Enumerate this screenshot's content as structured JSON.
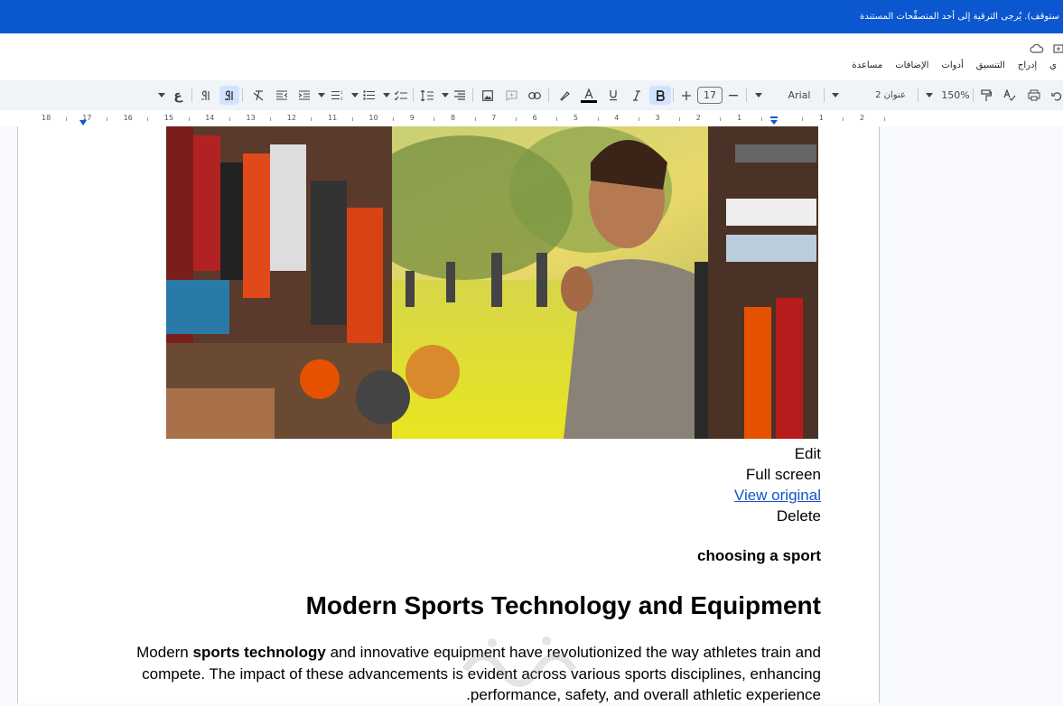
{
  "banner": {
    "text": "ستوقف). يُرجى الترقية إلى أحد المتصفِّحات المستندة"
  },
  "menu": {
    "items": [
      "ي",
      "إدراج",
      "التنسيق",
      "أدوات",
      "الإضافات",
      "مساعدة"
    ]
  },
  "toolbar": {
    "zoom": "150%",
    "style": "عنوان 2",
    "font": "Arial",
    "font_size": "17",
    "lang_label": "ع"
  },
  "ruler": {
    "labels": [
      "18",
      "17",
      "16",
      "15",
      "14",
      "13",
      "12",
      "11",
      "10",
      "9",
      "8",
      "7",
      "6",
      "5",
      "4",
      "3",
      "2",
      "1",
      "",
      "1",
      "2"
    ]
  },
  "image_menu": {
    "edit": "Edit",
    "full_screen": "Full screen",
    "view_original": "View original",
    "delete": "Delete"
  },
  "document": {
    "caption": "choosing a sport",
    "heading": "Modern Sports Technology and Equipment",
    "para_line1_pre": "Modern ",
    "para_line1_bold": "sports technology",
    "para_line1_post": " and innovative equipment have revolutionized the way athletes train and",
    "para_line2": "compete. The impact of these advancements is evident across various sports disciplines, enhancing",
    "para_line3": ".performance, safety, and overall athletic experience"
  },
  "colors": {
    "accent": "#0b57d0",
    "link": "#1155cc"
  }
}
